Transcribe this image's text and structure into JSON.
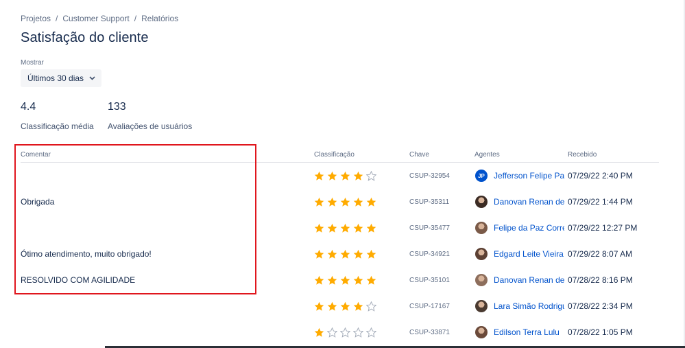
{
  "breadcrumb": [
    "Projetos",
    "Customer Support",
    "Relatórios"
  ],
  "breadcrumb_separator": "/",
  "page_title": "Satisfação do cliente",
  "filter": {
    "label": "Mostrar",
    "value": "Últimos 30 dias"
  },
  "stats": [
    {
      "value": "4.4",
      "label": "Classificação média"
    },
    {
      "value": "133",
      "label": "Avaliações de usuários"
    }
  ],
  "table": {
    "headers": {
      "comment": "Comentar",
      "rating": "Classificação",
      "key": "Chave",
      "agents": "Agentes",
      "received": "Recebido"
    },
    "rows": [
      {
        "comment": "",
        "rating": 4,
        "key": "CSUP-32954",
        "agent": "Jefferson Felipe Palmeira",
        "avatar": "initials-avatar",
        "initials": "JP",
        "received": "07/29/22 2:40 PM"
      },
      {
        "comment": "Obrigada",
        "rating": 5,
        "key": "CSUP-35311",
        "agent": "Danovan Renan de",
        "avatar": "photo-avatar",
        "received": "07/29/22 1:44 PM"
      },
      {
        "comment": "",
        "rating": 5,
        "key": "CSUP-35477",
        "agent": "Felipe da Paz Correia",
        "avatar": "photo-avatar",
        "received": "07/29/22 12:27 PM"
      },
      {
        "comment": "Ótimo atendimento, muito obrigado!",
        "rating": 5,
        "key": "CSUP-34921",
        "agent": "Edgard Leite Vieira",
        "avatar": "photo-avatar",
        "received": "07/29/22 8:07 AM"
      },
      {
        "comment": "RESOLVIDO COM AGILIDADE",
        "rating": 5,
        "key": "CSUP-35101",
        "agent": "Danovan Renan de",
        "avatar": "photo-avatar",
        "received": "07/28/22 8:16 PM"
      },
      {
        "comment": "",
        "rating": 4,
        "key": "CSUP-17167",
        "agent": "Lara Simão Rodrigues",
        "avatar": "photo-avatar",
        "received": "07/28/22 2:34 PM"
      },
      {
        "comment": "",
        "rating": 1,
        "key": "CSUP-33871",
        "agent": "Edilson Terra Lulu",
        "avatar": "photo-avatar",
        "received": "07/28/22 1:05 PM"
      }
    ]
  },
  "icons": {
    "star_filled": "star-filled-icon",
    "star_empty": "star-empty-icon",
    "dropdown": "chevron-down-icon"
  },
  "colors": {
    "star": "#ffab00",
    "star_empty": "#a5adba",
    "link": "#0052cc",
    "highlight": "#e0161d"
  }
}
